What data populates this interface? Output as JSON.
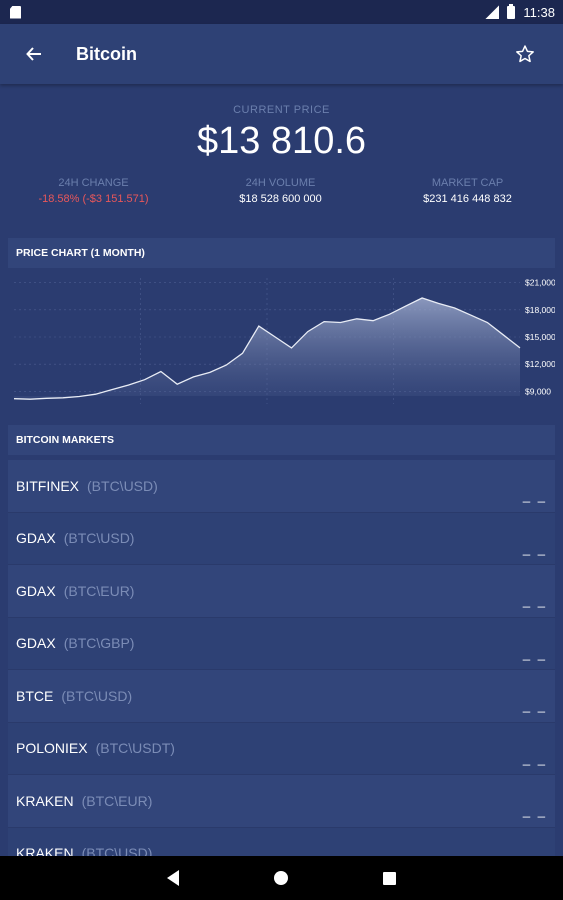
{
  "status_bar": {
    "time": "11:38"
  },
  "app_bar": {
    "title": "Bitcoin"
  },
  "price": {
    "label": "CURRENT PRICE",
    "value": "$13 810.6"
  },
  "stats": [
    {
      "label": "24H CHANGE",
      "value": "-18.58% (-$3 151.571)"
    },
    {
      "label": "24H VOLUME",
      "value": "$18 528 600 000"
    },
    {
      "label": "MARKET CAP",
      "value": "$231 416 448 832"
    }
  ],
  "chart": {
    "header": "PRICE CHART (1 MONTH)",
    "y_ticks": [
      "$21,000",
      "$18,000",
      "$15,000",
      "$12,000",
      "$9,000"
    ]
  },
  "chart_data": {
    "type": "area",
    "ylim": [
      8500,
      21500
    ],
    "y_tick_values": [
      21000,
      18000,
      15000,
      12000,
      9000
    ],
    "values": [
      8200,
      8150,
      8250,
      8300,
      8450,
      8700,
      9200,
      9700,
      10300,
      11200,
      9800,
      10600,
      11100,
      11900,
      13200,
      16200,
      15000,
      13800,
      15600,
      16700,
      16600,
      17000,
      16800,
      17500,
      18400,
      19300,
      18700,
      18200,
      17400,
      16600,
      15200,
      13800
    ],
    "grid": true
  },
  "markets": {
    "header": "BITCOIN MARKETS",
    "rows": [
      {
        "exchange": "BITFINEX",
        "pair": "(BTC\\USD)",
        "value": "_ _"
      },
      {
        "exchange": "GDAX",
        "pair": "(BTC\\USD)",
        "value": "_ _"
      },
      {
        "exchange": "GDAX",
        "pair": "(BTC\\EUR)",
        "value": "_ _"
      },
      {
        "exchange": "GDAX",
        "pair": "(BTC\\GBP)",
        "value": "_ _"
      },
      {
        "exchange": "BTCE",
        "pair": "(BTC\\USD)",
        "value": "_ _"
      },
      {
        "exchange": "POLONIEX",
        "pair": "(BTC\\USDT)",
        "value": "_ _"
      },
      {
        "exchange": "KRAKEN",
        "pair": "(BTC\\EUR)",
        "value": "_ _"
      },
      {
        "exchange": "KRAKEN",
        "pair": "(BTC\\USD)",
        "value": ""
      }
    ]
  },
  "icons": {
    "back": "arrow-left-icon",
    "favorite": "star-outline-icon"
  }
}
